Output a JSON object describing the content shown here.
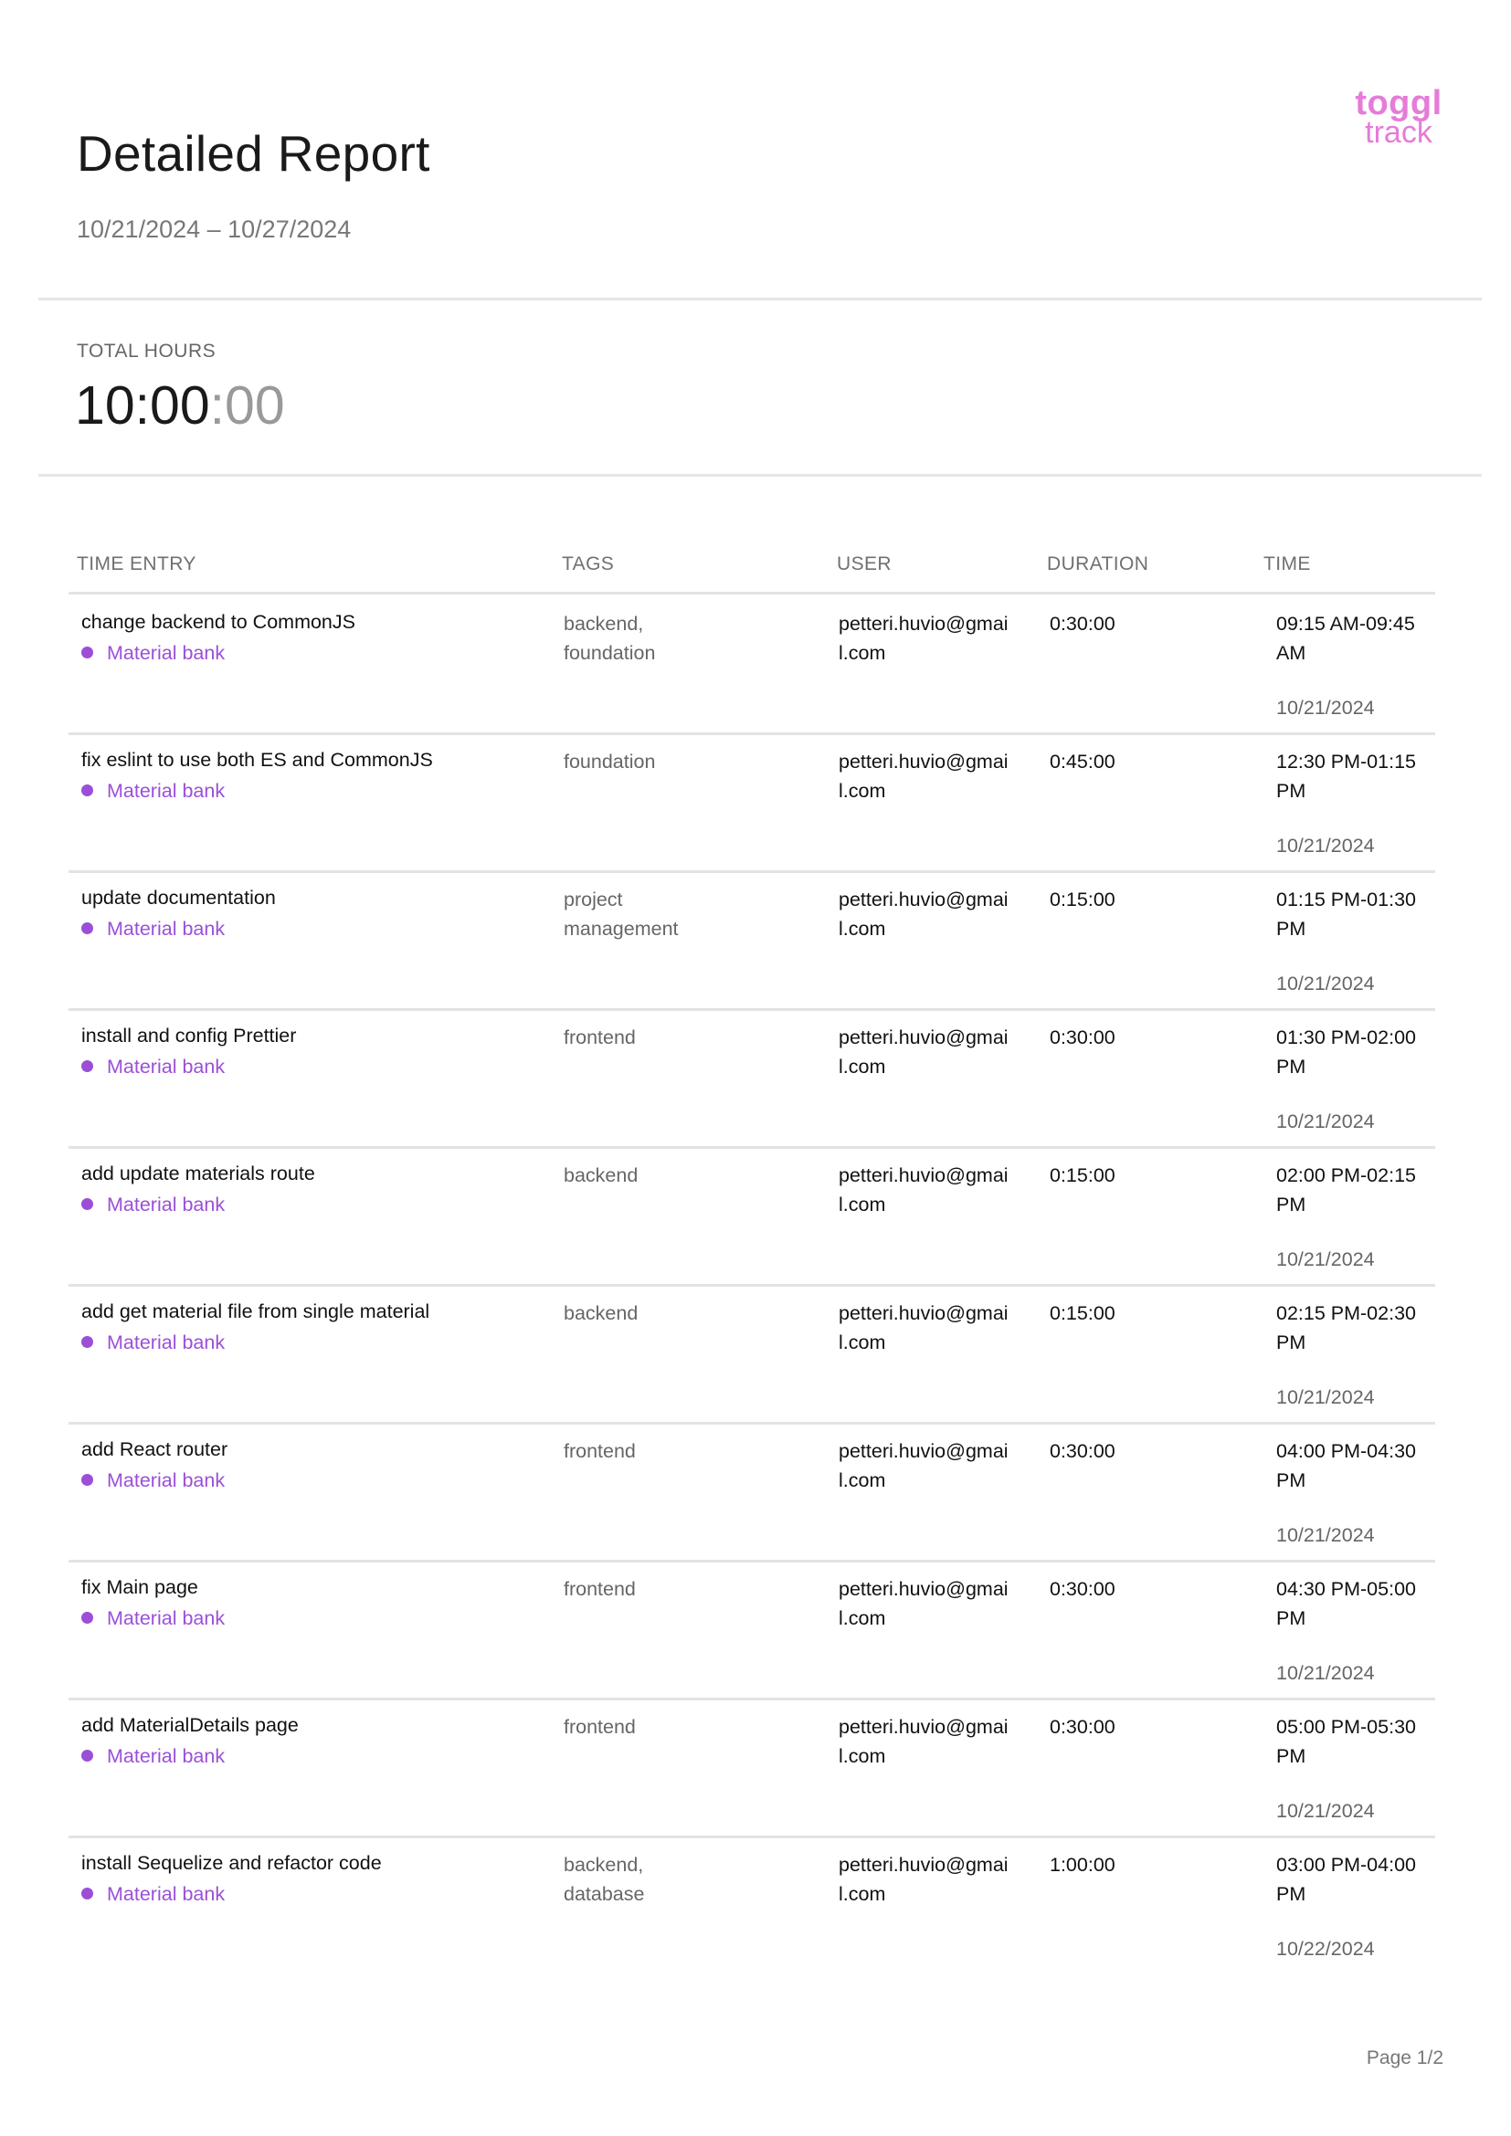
{
  "report": {
    "title": "Detailed Report",
    "date_range": "10/21/2024 – 10/27/2024"
  },
  "logo": {
    "line1": "toggl",
    "line2": "track",
    "color": "#e57cd8"
  },
  "totals": {
    "label": "TOTAL HOURS",
    "hours_minutes": "10:00",
    "seconds": ":00"
  },
  "columns": {
    "entry": "TIME ENTRY",
    "tags": "TAGS",
    "user": "USER",
    "duration": "DURATION",
    "time": "TIME"
  },
  "project_color": "#9b4fd8",
  "entries": [
    {
      "description": "change backend to CommonJS",
      "project": "Material bank",
      "tags": "backend, foundation",
      "user": "petteri.huvio@gmail.com",
      "duration": "0:30:00",
      "time_range": "09:15 AM-09:45 AM",
      "date": "10/21/2024"
    },
    {
      "description": "fix eslint to use both ES and CommonJS",
      "project": "Material bank",
      "tags": "foundation",
      "user": "petteri.huvio@gmail.com",
      "duration": "0:45:00",
      "time_range": "12:30 PM-01:15 PM",
      "date": "10/21/2024"
    },
    {
      "description": "update documentation",
      "project": "Material bank",
      "tags": "project management",
      "user": "petteri.huvio@gmail.com",
      "duration": "0:15:00",
      "time_range": "01:15 PM-01:30 PM",
      "date": "10/21/2024"
    },
    {
      "description": "install and config Prettier",
      "project": "Material bank",
      "tags": "frontend",
      "user": "petteri.huvio@gmail.com",
      "duration": "0:30:00",
      "time_range": "01:30 PM-02:00 PM",
      "date": "10/21/2024"
    },
    {
      "description": "add update materials route",
      "project": "Material bank",
      "tags": "backend",
      "user": "petteri.huvio@gmail.com",
      "duration": "0:15:00",
      "time_range": "02:00 PM-02:15 PM",
      "date": "10/21/2024"
    },
    {
      "description": "add get material file from single material",
      "project": "Material bank",
      "tags": "backend",
      "user": "petteri.huvio@gmail.com",
      "duration": "0:15:00",
      "time_range": "02:15 PM-02:30 PM",
      "date": "10/21/2024"
    },
    {
      "description": "add React router",
      "project": "Material bank",
      "tags": "frontend",
      "user": "petteri.huvio@gmail.com",
      "duration": "0:30:00",
      "time_range": "04:00 PM-04:30 PM",
      "date": "10/21/2024"
    },
    {
      "description": "fix Main page",
      "project": "Material bank",
      "tags": "frontend",
      "user": "petteri.huvio@gmail.com",
      "duration": "0:30:00",
      "time_range": "04:30 PM-05:00 PM",
      "date": "10/21/2024"
    },
    {
      "description": "add MaterialDetails page",
      "project": "Material bank",
      "tags": "frontend",
      "user": "petteri.huvio@gmail.com",
      "duration": "0:30:00",
      "time_range": "05:00 PM-05:30 PM",
      "date": "10/21/2024"
    },
    {
      "description": "install Sequelize and refactor code",
      "project": "Material bank",
      "tags": "backend, database",
      "user": "petteri.huvio@gmail.com",
      "duration": "1:00:00",
      "time_range": "03:00 PM-04:00 PM",
      "date": "10/22/2024"
    }
  ],
  "footer": {
    "page": "Page 1/2"
  }
}
